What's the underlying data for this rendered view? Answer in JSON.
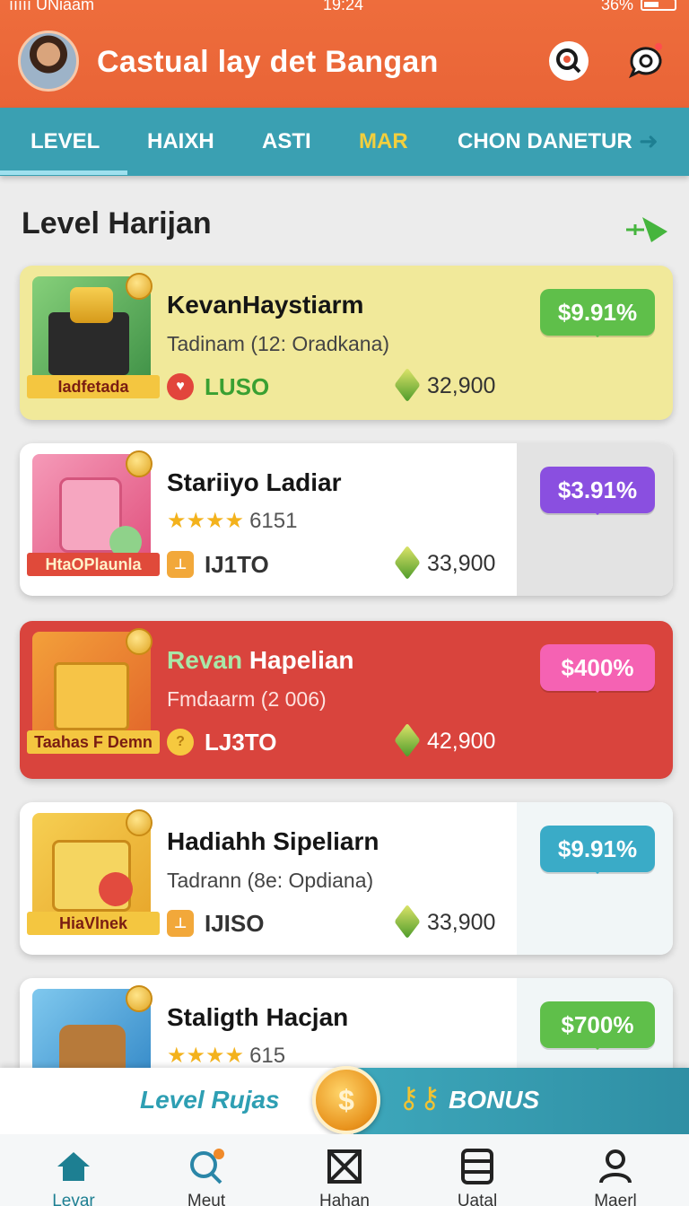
{
  "status_bar": {
    "carrier": "ııııı UNiaam",
    "time": "19:24",
    "battery": "36%"
  },
  "header": {
    "title": "Castual lay det Bangan",
    "icons": [
      "search-icon",
      "notification-icon"
    ]
  },
  "tabs": [
    {
      "label": "LEVEL",
      "active": true
    },
    {
      "label": "HAIXH",
      "active": false
    },
    {
      "label": "ASTI",
      "active": false
    },
    {
      "label": "MAR",
      "active": false,
      "color": "#f2cf3d"
    },
    {
      "label": "CHON DANETUR",
      "active": false
    }
  ],
  "section": {
    "title": "Level Harijan"
  },
  "cards": [
    {
      "title": "KevanHaystiarm",
      "subtitle": "Tadinam (12: Oradkana)",
      "ribbon": "Iadfetada",
      "tag": "LUSO",
      "price": "32,900",
      "percent": "$9.91%",
      "bg": "#f1e99a",
      "pct_color": "#5fbf4a",
      "tag_color": "#3aa032"
    },
    {
      "title": "Stariiyo Ladiar",
      "stars": "★★★★",
      "rating": "6151",
      "ribbon": "HtaOPlaunla",
      "tag": "IJ1TO",
      "price": "33,900",
      "percent": "$3.91%",
      "bg": "#ffffff",
      "pct_color": "#8a4fe0",
      "tag_color": "#333333"
    },
    {
      "title_part1": "Revan",
      "title_part2": "Hapelian",
      "subtitle": "Fmdaarm (2 006)",
      "ribbon": "Taahas F Demn",
      "tag": "LJ3TO",
      "price": "42,900",
      "percent": "$400%",
      "bg": "#d9443d",
      "pct_color": "#f562b3",
      "tag_color": "#ffffff"
    },
    {
      "title": "Hadiahh Sipeliarn",
      "subtitle": "Tadrann (8e: Opdiana)",
      "ribbon": "HiaVlnek",
      "tag": "IJISO",
      "price": "33,900",
      "percent": "$9.91%",
      "bg": "#ffffff",
      "pct_color": "#3aabc7",
      "tag_color": "#333333"
    },
    {
      "title": "Staligth Hacjan",
      "stars": "★★★★",
      "rating": "615",
      "percent": "$700%",
      "bg": "#ffffff",
      "pct_color": "#5fbf4a"
    }
  ],
  "promo": {
    "left_label": "Level Rujas",
    "coin_symbol": "$",
    "right_label": "BONUS"
  },
  "nav": [
    {
      "label": "Levar",
      "icon": "home-icon",
      "active": true
    },
    {
      "label": "Meut",
      "icon": "search-icon",
      "active": false
    },
    {
      "label": "Hahan",
      "icon": "box-icon",
      "active": false
    },
    {
      "label": "Uatal",
      "icon": "list-icon",
      "active": false
    },
    {
      "label": "Maerl",
      "icon": "profile-icon",
      "active": false
    }
  ]
}
